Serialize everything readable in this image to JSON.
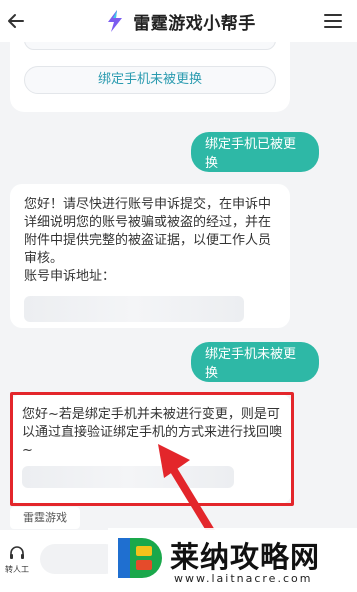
{
  "header": {
    "title": "雷霆游戏小帮手"
  },
  "chat": {
    "option_cut_label": "绑定手机已被更换",
    "option_label": "绑定手机未被更换",
    "user_messages": [
      "绑定手机已被更换",
      "绑定手机未被更换"
    ],
    "bot_reply_1": "您好！请尽快进行账号申诉提交，在申诉中详细说明您的账号被骗或被盗的经过，并在附件中提供完整的被盗证据，以便工作人员审核。",
    "appeal_label": "账号申诉地址：",
    "bot_reply_2": "您好~若是绑定手机并未被进行变更，则是可以通过直接验证绑定手机的方式来进行找回噢~",
    "sender_name": "雷霆游戏"
  },
  "bottom": {
    "human_label": "转人工"
  },
  "watermark": {
    "title": "莱纳攻略网",
    "url": "www.laitnacre.com"
  },
  "colors": {
    "accent": "#2eb8a6",
    "highlight": "#e3262b",
    "link": "#2b9bb0"
  }
}
